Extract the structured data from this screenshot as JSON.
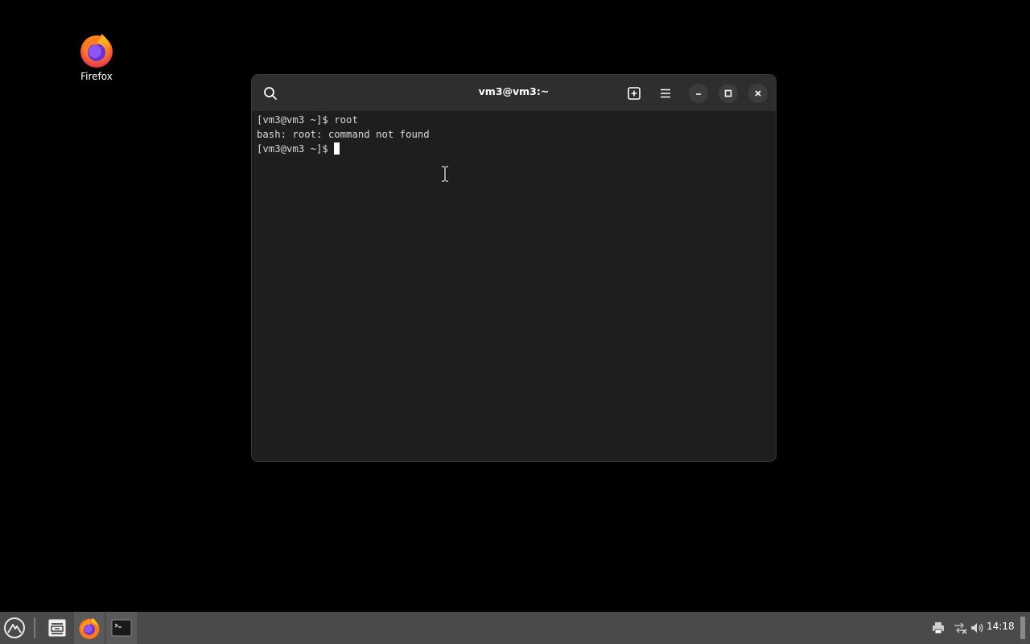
{
  "desktop": {
    "icons": [
      {
        "label": "Firefox",
        "icon": "firefox-icon"
      }
    ]
  },
  "terminal": {
    "title": "vm3@vm3:~",
    "lines": [
      "[vm3@vm3 ~]$ root",
      "bash: root: command not found"
    ],
    "prompt": "[vm3@vm3 ~]$ ",
    "buttons": {
      "search": "search-icon",
      "new_tab": "new-tab-icon",
      "menu": "hamburger-menu-icon",
      "minimize": "minimize-icon",
      "maximize": "maximize-icon",
      "close": "close-icon"
    }
  },
  "taskbar": {
    "clock": "14:18",
    "apps": [
      "app-menu-icon",
      "file-manager-icon",
      "firefox-icon",
      "terminal-icon"
    ],
    "tray": [
      "printer-icon",
      "network-icon",
      "volume-icon"
    ]
  },
  "colors": {
    "desktop_bg": "#000000",
    "window_bg": "#1e1e1e",
    "titlebar_bg": "#2e2e2e",
    "taskbar_bg": "#4a4a4a",
    "text": "#d9d9d9"
  }
}
